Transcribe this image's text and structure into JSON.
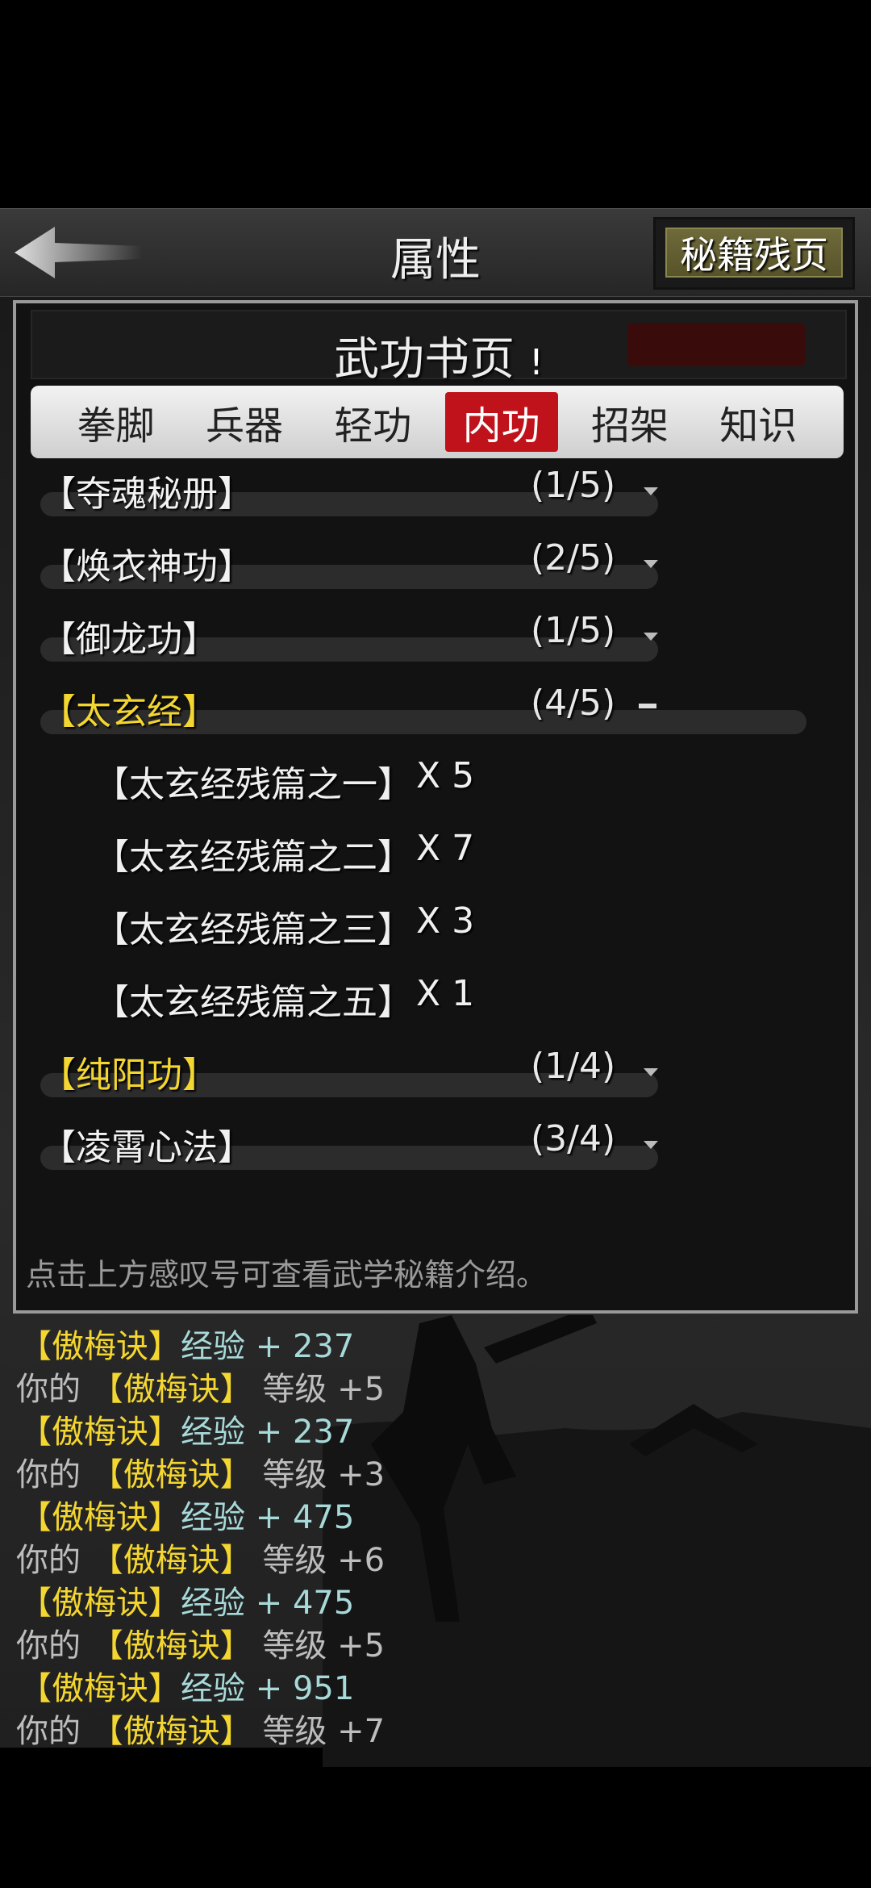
{
  "header": {
    "title": "属性",
    "fragments_button": "秘籍残页"
  },
  "panel": {
    "title": "武功书页",
    "info_mark": "!",
    "tabs": [
      "拳脚",
      "兵器",
      "轻功",
      "内功",
      "招架",
      "知识"
    ],
    "active_tab": "内功",
    "books": [
      {
        "name": "【夺魂秘册】",
        "count": "(1/5)",
        "expanded": false,
        "gold": false
      },
      {
        "name": "【焕衣神功】",
        "count": "(2/5)",
        "expanded": false,
        "gold": false
      },
      {
        "name": "【御龙功】",
        "count": "(1/5)",
        "expanded": false,
        "gold": false
      },
      {
        "name": "【太玄经】",
        "count": "(4/5)",
        "expanded": true,
        "gold": true
      },
      {
        "name": "【纯阳功】",
        "count": "(1/4)",
        "expanded": false,
        "gold": true
      },
      {
        "name": "【凌霄心法】",
        "count": "(3/4)",
        "expanded": false,
        "gold": false
      }
    ],
    "fragments": [
      {
        "name": "【太玄经残篇之一】",
        "qty": "X 5"
      },
      {
        "name": "【太玄经残篇之二】",
        "qty": "X 7"
      },
      {
        "name": "【太玄经残篇之三】",
        "qty": "X 3"
      },
      {
        "name": "【太玄经残篇之五】",
        "qty": "X 1"
      }
    ],
    "hint": "点击上方感叹号可查看武学秘籍介绍。"
  },
  "log": [
    {
      "skill": "【傲梅诀】",
      "label": "经验",
      "value": "+ 237"
    },
    {
      "prefix": "你的",
      "skill": "【傲梅诀】",
      "label": "等级",
      "value": "+5"
    },
    {
      "skill": "【傲梅诀】",
      "label": "经验",
      "value": "+ 237"
    },
    {
      "prefix": "你的",
      "skill": "【傲梅诀】",
      "label": "等级",
      "value": "+3"
    },
    {
      "skill": "【傲梅诀】",
      "label": "经验",
      "value": "+ 475"
    },
    {
      "prefix": "你的",
      "skill": "【傲梅诀】",
      "label": "等级",
      "value": "+6"
    },
    {
      "skill": "【傲梅诀】",
      "label": "经验",
      "value": "+ 475"
    },
    {
      "prefix": "你的",
      "skill": "【傲梅诀】",
      "label": "等级",
      "value": "+5"
    },
    {
      "skill": "【傲梅诀】",
      "label": "经验",
      "value": "+ 951"
    },
    {
      "prefix": "你的",
      "skill": "【傲梅诀】",
      "label": "等级",
      "value": "+7"
    }
  ],
  "colors": {
    "gold": "#f4d630",
    "active_tab": "#c0121a",
    "fragments_button": "#6e6a3a"
  }
}
